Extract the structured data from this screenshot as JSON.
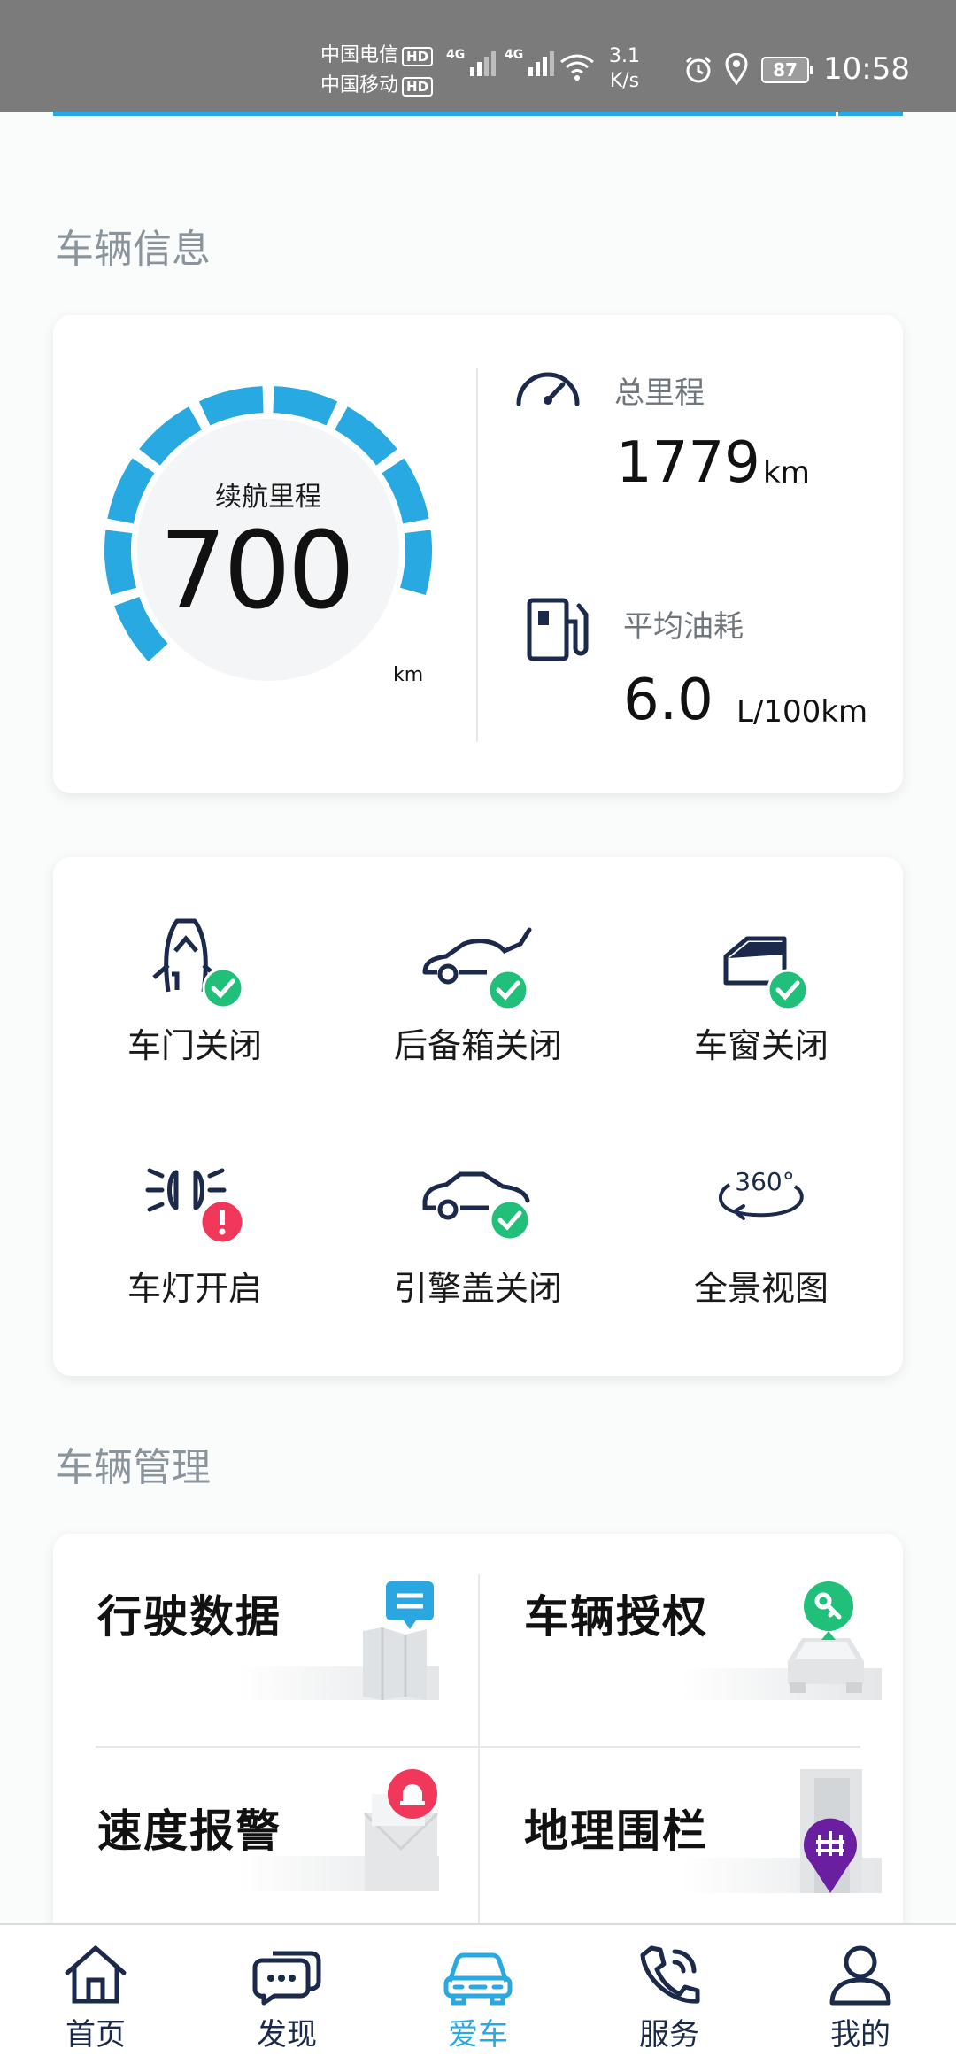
{
  "status_bar": {
    "carrier1": "中国电信",
    "carrier2": "中国移动",
    "hd": "HD",
    "net1": "4G",
    "net2": "4G",
    "speed_value": "3.1",
    "speed_unit": "K/s",
    "battery": "87",
    "time": "10:58"
  },
  "vehicle_info": {
    "title": "车辆信息",
    "range_label": "续航里程",
    "range_value": "700",
    "range_unit": "km",
    "range_level": 0.85,
    "total_mileage_label": "总里程",
    "total_mileage_value": "1779",
    "total_mileage_unit": "km",
    "avg_fuel_label": "平均油耗",
    "avg_fuel_value": "6.0",
    "avg_fuel_unit": "L/100km"
  },
  "status_grid": [
    {
      "label": "车门关闭",
      "icon": "car-door-icon",
      "badge": "check"
    },
    {
      "label": "后备箱关闭",
      "icon": "car-trunk-icon",
      "badge": "check"
    },
    {
      "label": "车窗关闭",
      "icon": "car-window-icon",
      "badge": "check"
    },
    {
      "label": "车灯开启",
      "icon": "car-light-icon",
      "badge": "alert"
    },
    {
      "label": "引擎盖关闭",
      "icon": "car-hood-icon",
      "badge": "check"
    },
    {
      "label": "全景视图",
      "icon": "panorama-360-icon",
      "badge": "360°"
    }
  ],
  "vehicle_mgmt": {
    "title": "车辆管理",
    "items": [
      {
        "label": "行驶数据",
        "icon": "map-message-icon"
      },
      {
        "label": "车辆授权",
        "icon": "car-key-icon"
      },
      {
        "label": "速度报警",
        "icon": "alarm-mail-icon"
      },
      {
        "label": "地理围栏",
        "icon": "geofence-icon"
      }
    ]
  },
  "bottom_nav": [
    {
      "label": "首页",
      "icon": "home-icon"
    },
    {
      "label": "发现",
      "icon": "chat-bubbles-icon"
    },
    {
      "label": "爱车",
      "icon": "car-icon",
      "active": true
    },
    {
      "label": "服务",
      "icon": "phone-icon"
    },
    {
      "label": "我的",
      "icon": "person-icon"
    }
  ],
  "colors": {
    "accent": "#29a9e1",
    "check_green": "#21c07a",
    "alert_red": "#f2385a",
    "navy": "#1b2a4a",
    "purple": "#6a1fa0"
  }
}
